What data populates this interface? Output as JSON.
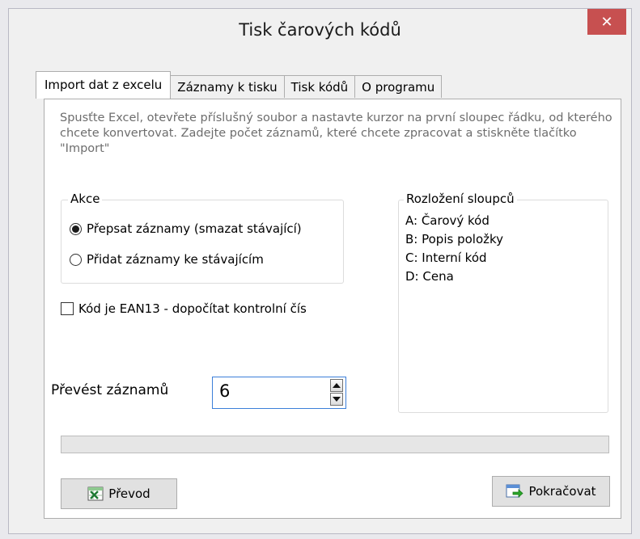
{
  "window": {
    "title": "Tisk čarových kódů",
    "close_glyph": "✕"
  },
  "tabs": [
    {
      "label": "Import dat z excelu",
      "active": true
    },
    {
      "label": "Záznamy k tisku",
      "active": false
    },
    {
      "label": "Tisk kódů",
      "active": false
    },
    {
      "label": "O programu",
      "active": false
    }
  ],
  "instructions": "Spusťte Excel, otevřete příslušný soubor a nastavte kurzor na první sloupec řádku, od kterého chcete konvertovat. Zadejte počet záznamů, které chcete zpracovat a stiskněte tlačítko \"Import\"",
  "action_group": {
    "label": "Akce",
    "options": [
      {
        "label": "Přepsat záznamy (smazat stávající)",
        "selected": true
      },
      {
        "label": "Přidat záznamy ke stávajícím",
        "selected": false
      }
    ]
  },
  "ean_checkbox": {
    "label": "Kód je EAN13 - dopočítat kontrolní čís",
    "checked": false
  },
  "convert_count": {
    "label": "Převést záznamů",
    "value": "6"
  },
  "column_layout": {
    "title": "Rozložení sloupců",
    "lines": [
      "A: Čarový kód",
      "B: Popis položky",
      "C: Interní kód",
      "D: Cena"
    ]
  },
  "progress": {
    "fraction": 0.0
  },
  "buttons": {
    "convert": "Převod",
    "continue": "Pokračovat"
  },
  "icons": {
    "close": "close-icon",
    "spin_up": "triangle-up-icon",
    "spin_down": "triangle-down-icon",
    "convert": "excel-icon",
    "continue": "continue-arrow-icon"
  },
  "colors": {
    "close_button": "#c75050",
    "spin_focus_border": "#3c7fd9",
    "progress_fill": "#06b025"
  }
}
